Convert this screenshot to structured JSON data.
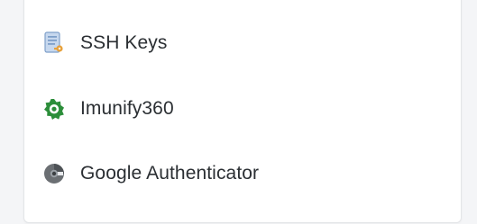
{
  "tools_panel": {
    "items": [
      {
        "label": "SSH Keys",
        "icon": "ssh-keys-icon"
      },
      {
        "label": "Imunify360",
        "icon": "imunify360-icon"
      },
      {
        "label": "Google Authenticator",
        "icon": "google-authenticator-icon"
      }
    ]
  },
  "colors": {
    "text": "#2b2f33",
    "ssh_doc": "#8fb0d9",
    "ssh_key": "#e7a13b",
    "imunify": "#2c8e3a",
    "google_auth": "#5f6368"
  }
}
